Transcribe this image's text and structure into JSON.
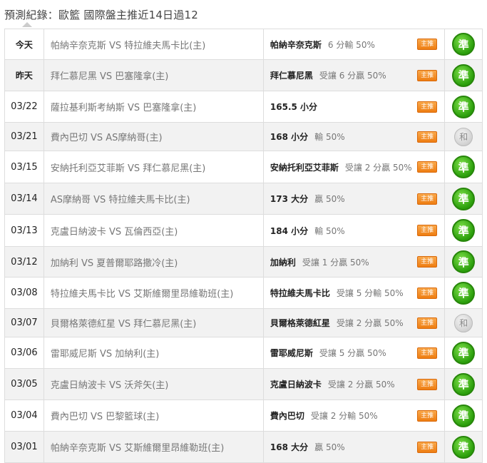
{
  "header": {
    "title": "預測紀錄：歐籃 國際盤主推近14日過12"
  },
  "rows": [
    {
      "date": "今天",
      "match": "帕納辛奈克斯 VS 特拉維夫馬卡比(主)",
      "pick_team": "帕納辛奈克斯",
      "pick_note": "6 分輸 50%",
      "badge": "主推",
      "result": "準",
      "result_type": "win"
    },
    {
      "date": "昨天",
      "match": "拜仁慕尼黑 VS 巴塞隆拿(主)",
      "pick_team": "拜仁慕尼黑",
      "pick_note": "受讓 6 分贏 50%",
      "badge": "主推",
      "result": "準",
      "result_type": "win"
    },
    {
      "date": "03/22",
      "match": "薩拉基利斯考納斯 VS 巴塞隆拿(主)",
      "pick_team": "165.5 小分",
      "pick_note": "",
      "badge": "主推",
      "result": "準",
      "result_type": "win"
    },
    {
      "date": "03/21",
      "match": "費內巴切 VS AS摩納哥(主)",
      "pick_team": "168 小分",
      "pick_note": "輸 50%",
      "badge": "主推",
      "result": "likely 和",
      "result_type": "tie"
    },
    {
      "date": "03/15",
      "match": "安納托利亞艾菲斯 VS 拜仁慕尼黑(主)",
      "pick_team": "安納托利亞艾菲斯",
      "pick_note": "受讓 2 分贏 50%",
      "badge": "主推",
      "result": "準",
      "result_type": "win"
    },
    {
      "date": "03/14",
      "match": "AS摩納哥 VS 特拉維夫馬卡比(主)",
      "pick_team": "173 大分",
      "pick_note": "贏 50%",
      "badge": "主推",
      "result": "準",
      "result_type": "win"
    },
    {
      "date": "03/13",
      "match": "克盧日納波卡 VS 瓦倫西亞(主)",
      "pick_team": "184 小分",
      "pick_note": "輸 50%",
      "badge": "主推",
      "result": "準",
      "result_type": "win"
    },
    {
      "date": "03/12",
      "match": "加納利 VS 夏普爾耶路撒冷(主)",
      "pick_team": "加納利",
      "pick_note": "受讓 1 分贏 50%",
      "badge": "主推",
      "result": "準",
      "result_type": "win"
    },
    {
      "date": "03/08",
      "match": "特拉維夫馬卡比 VS 艾斯維爾里昂維勒班(主)",
      "pick_team": "特拉維夫馬卡比",
      "pick_note": "受讓 5 分輸 50%",
      "badge": "主推",
      "result": "準",
      "result_type": "win"
    },
    {
      "date": "03/07",
      "match": "貝爾格萊德紅星 VS 拜仁慕尼黑(主)",
      "pick_team": "貝爾格萊德紅星",
      "pick_note": "受讓 2 分贏 50%",
      "badge": "主推",
      "result": "likely 和",
      "result_type": "tie"
    },
    {
      "date": "03/06",
      "match": "雷耶威尼斯 VS 加納利(主)",
      "pick_team": "雷耶威尼斯",
      "pick_note": "受讓 5 分贏 50%",
      "badge": "主推",
      "result": "準",
      "result_type": "win"
    },
    {
      "date": "03/05",
      "match": "克盧日納波卡 VS 沃斧矢(主)",
      "pick_team": "克盧日納波卡",
      "pick_note": "受讓 2 分贏 50%",
      "badge": "主推",
      "result": "準",
      "result_type": "win"
    },
    {
      "date": "03/04",
      "match": "費內巴切 VS 巴黎籃球(主)",
      "pick_team": "費內巴切",
      "pick_note": "受讓 2 分輸 50%",
      "badge": "主推",
      "result": "準",
      "result_type": "win"
    },
    {
      "date": "03/01",
      "match": "帕納辛奈克斯 VS 艾斯維爾里昂維勒班(主)",
      "pick_team": "168 大分",
      "pick_note": "贏 50%",
      "badge": "主推",
      "result": "準",
      "result_type": "win"
    }
  ]
}
